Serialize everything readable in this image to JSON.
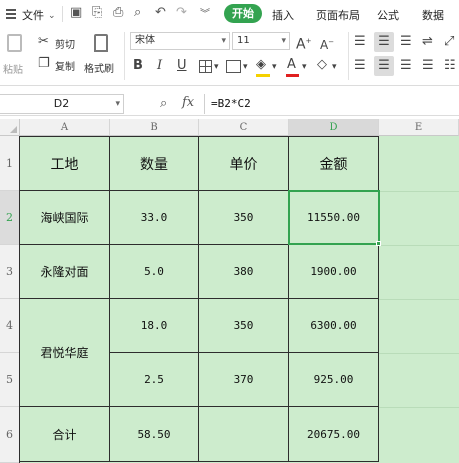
{
  "menu": {
    "file": "文件",
    "start": "开始",
    "insert": "插入",
    "layout": "页面布局",
    "formula": "公式",
    "data": "数据"
  },
  "ribbon": {
    "paste": "粘贴",
    "cut": "剪切",
    "copy": "复制",
    "format_painter": "格式刷",
    "font_name": "宋体",
    "font_size": "11",
    "bold": "B",
    "italic": "I",
    "underline": "U",
    "grow_font": "A",
    "shrink_font": "A"
  },
  "formula_bar": {
    "cell_ref": "D2",
    "fx": "fx",
    "formula": "=B2*C2"
  },
  "columns": [
    "A",
    "B",
    "C",
    "D",
    "E"
  ],
  "rows": [
    "1",
    "2",
    "3",
    "4",
    "5",
    "6"
  ],
  "table": {
    "headers": [
      "工地",
      "数量",
      "单价",
      "金额"
    ],
    "r2": [
      "海峡国际",
      "33.0",
      "350",
      "11550.00"
    ],
    "r3": [
      "永隆对面",
      "5.0",
      "380",
      "1900.00"
    ],
    "r4": [
      "君悦华庭",
      "18.0",
      "350",
      "6300.00"
    ],
    "r5": [
      "2.5",
      "370",
      "925.00"
    ],
    "r6": [
      "合计",
      "58.50",
      "",
      "20675.00"
    ]
  },
  "colors": {
    "accent": "#33a350",
    "cell_fill": "#cdeccd",
    "selection": "#33a350"
  }
}
